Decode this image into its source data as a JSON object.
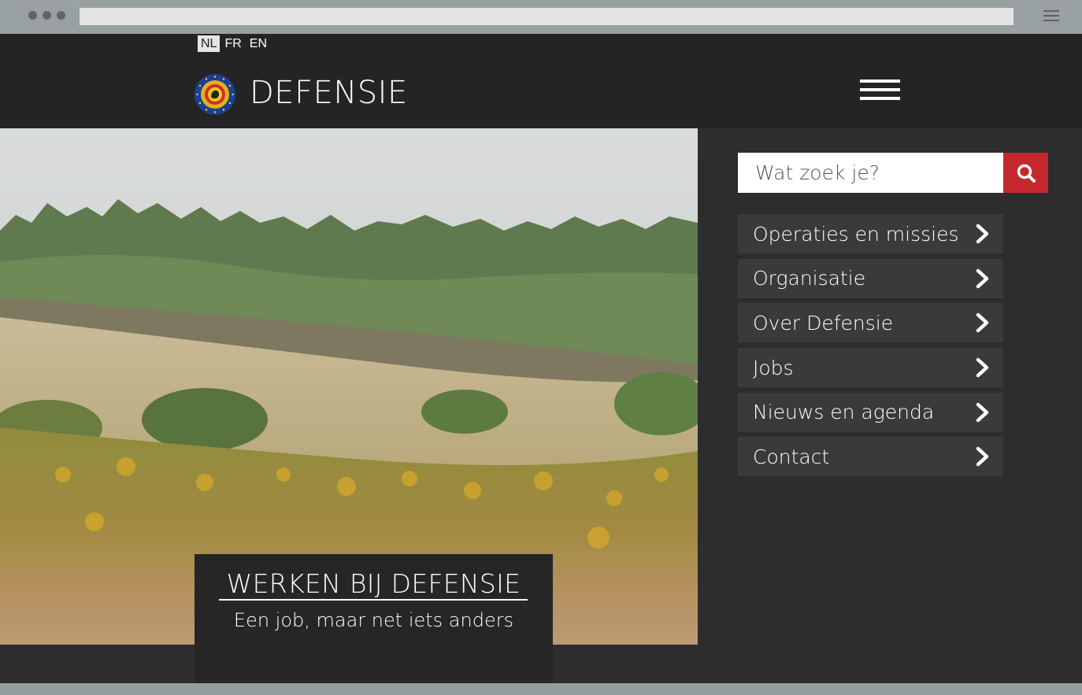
{
  "header": {
    "languages": [
      {
        "code": "NL",
        "active": true
      },
      {
        "code": "FR",
        "active": false
      },
      {
        "code": "EN",
        "active": false
      }
    ],
    "brand": "DEFENSIE",
    "menu_icon": "hamburger-icon"
  },
  "search": {
    "placeholder": "Wat zoek je?",
    "button_icon": "search-icon"
  },
  "nav": {
    "items": [
      {
        "label": "Operaties en missies"
      },
      {
        "label": "Organisatie"
      },
      {
        "label": "Over Defensie"
      },
      {
        "label": "Jobs"
      },
      {
        "label": "Nieuws en agenda"
      },
      {
        "label": "Contact"
      }
    ]
  },
  "hero": {
    "title": "WERKEN BIJ DEFENSIE",
    "subtitle": "Een job, maar net iets anders"
  },
  "colors": {
    "header_bg": "#242424",
    "body_bg": "#2d2d2d",
    "nav_item_bg": "#3a3a3a",
    "search_button": "#c4282c"
  }
}
